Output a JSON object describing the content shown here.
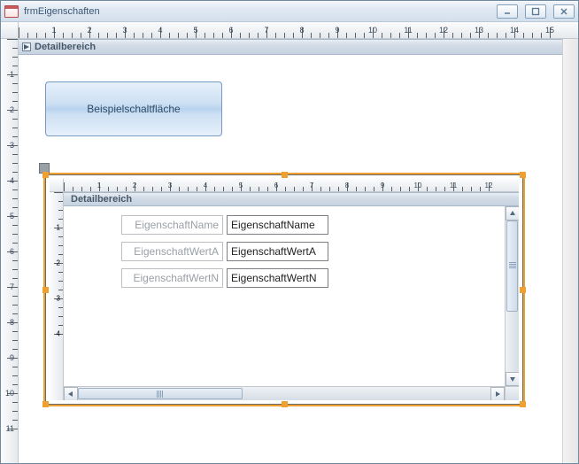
{
  "window": {
    "title": "frmEigenschaften"
  },
  "outer_section": {
    "header": "Detailbereich",
    "button_label": "Beispielschaltfläche"
  },
  "subform": {
    "section_header": "Detailbereich",
    "fields": [
      {
        "label": "EigenschaftName",
        "bound": "EigenschaftName"
      },
      {
        "label": "EigenschaftWertA",
        "bound": "EigenschaftWertA"
      },
      {
        "label": "EigenschaftWertN",
        "bound": "EigenschaftWertN"
      }
    ]
  },
  "ruler": {
    "outer_max_cm": 15,
    "inner_max_cm": 12,
    "outer_v_max_cm": 11,
    "inner_v_max_cm": 4
  },
  "colors": {
    "selection": "#f0a030",
    "button_grad_top": "#e7f0fb",
    "button_grad_bottom": "#b8d3ee"
  }
}
